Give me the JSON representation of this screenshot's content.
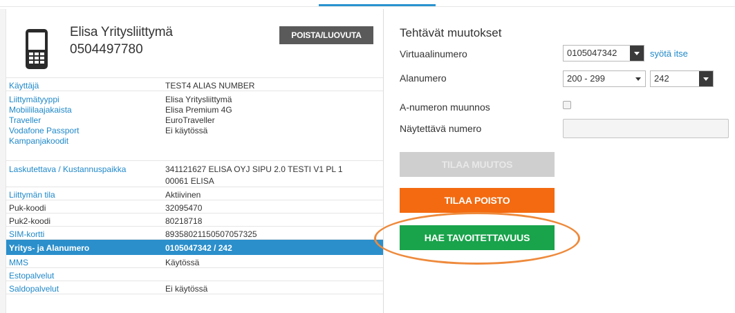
{
  "subscription": {
    "name": "Elisa Yritysliittymä",
    "number": "0504497780",
    "remove_button": "POISTA/LUOVUTA"
  },
  "details": [
    {
      "labels": [
        {
          "text": "Käyttäjä",
          "link": true
        }
      ],
      "values": [
        "TEST4 ALIAS NUMBER"
      ]
    },
    {
      "labels": [
        {
          "text": "Liittymätyyppi",
          "link": true
        },
        {
          "text": "Mobiililaajakaista",
          "link": true
        },
        {
          "text": "Traveller",
          "link": true
        },
        {
          "text": "Vodafone Passport",
          "link": true
        },
        {
          "text": "Kampanjakoodit",
          "link": true
        }
      ],
      "values": [
        "Elisa Yritysliittymä",
        "Elisa Premium 4G",
        "EuroTraveller",
        "Ei käytössä",
        ""
      ]
    },
    {
      "labels": [
        {
          "text": "Laskutettava / Kustannuspaikka",
          "link": true
        }
      ],
      "values": [
        "341121627 ELISA OYJ SIPU 2.0 TESTI V1 PL 1",
        "00061 ELISA"
      ]
    },
    {
      "labels": [
        {
          "text": "Liittymän tila",
          "link": true
        }
      ],
      "values": [
        "Aktiivinen"
      ]
    },
    {
      "labels": [
        {
          "text": "Puk-koodi",
          "link": false
        }
      ],
      "values": [
        "32095470"
      ]
    },
    {
      "labels": [
        {
          "text": "Puk2-koodi",
          "link": false
        }
      ],
      "values": [
        "80218718"
      ]
    },
    {
      "labels": [
        {
          "text": "SIM-kortti",
          "link": true
        }
      ],
      "values": [
        "89358021150507057325"
      ]
    },
    {
      "labels": [
        {
          "text": "Yritys- ja Alanumero",
          "link": false
        }
      ],
      "values": [
        "0105047342 / 242"
      ],
      "selected": true
    },
    {
      "labels": [
        {
          "text": "MMS",
          "link": true
        }
      ],
      "values": [
        "Käytössä"
      ]
    },
    {
      "labels": [
        {
          "text": "Estopalvelut",
          "link": true
        }
      ],
      "values": [
        ""
      ]
    },
    {
      "labels": [
        {
          "text": "Saldopalvelut",
          "link": true
        }
      ],
      "values": [
        "Ei käytössä"
      ]
    }
  ],
  "changes": {
    "title": "Tehtävät muutokset",
    "virtual_label": "Virtuaalinumero",
    "virtual_value": "0105047342",
    "own_link": "syötä itse",
    "sub_label": "Alanumero",
    "sub_range_value": "200 - 299",
    "sub_number_value": "242",
    "conversion_label": "A-numeron muunnos",
    "display_label": "Näytettävä numero",
    "display_value": "",
    "order_change": "TILAA MUUTOS",
    "order_removal": "TILAA POISTO",
    "fetch_reachability": "HAE TAVOITETTAVUUS"
  },
  "colors": {
    "link": "#1f88c9",
    "selected_row": "#2b8fcb",
    "orange_button": "#f36a10",
    "green_button": "#19a34b",
    "highlight": "#ee8a3c"
  }
}
